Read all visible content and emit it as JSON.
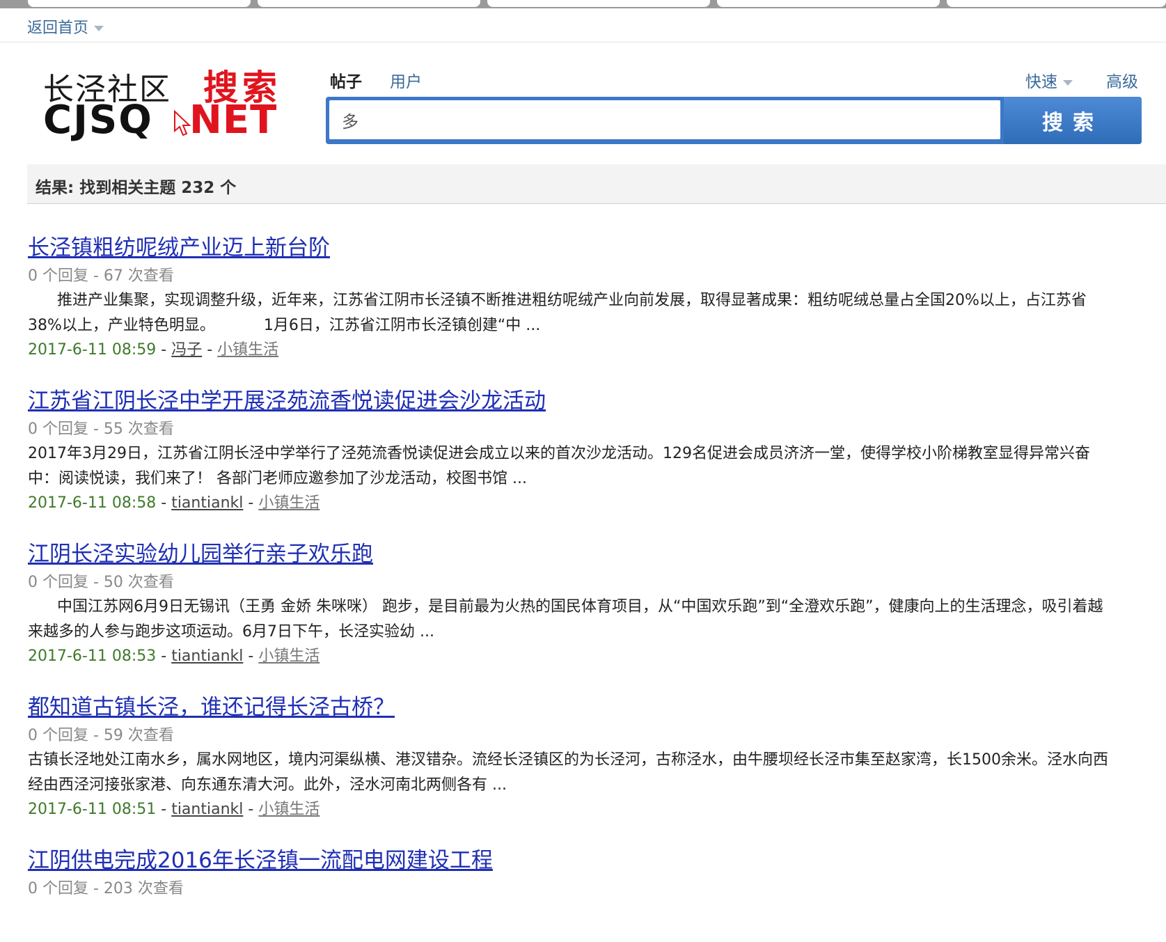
{
  "topbar": {
    "home_label": "返回首页"
  },
  "logo": {
    "cn_text": "长泾社区",
    "search_text": "搜索",
    "en_left": "CJSQ",
    "en_right": "NET"
  },
  "search": {
    "tabs": [
      {
        "label": "帖子"
      },
      {
        "label": "用户"
      }
    ],
    "quick_label": "快速",
    "advanced_label": "高级",
    "input_value": "多",
    "button_label": "搜索"
  },
  "results_bar": {
    "text": "结果: 找到相关主题 232 个"
  },
  "results": [
    {
      "title": "长泾镇粗纺呢绒产业迈上新台阶",
      "stats": "0 个回复 - 67 次查看",
      "summary": "      推进产业集聚，实现调整升级，近年来，江苏省江阴市长泾镇不断推进粗纺呢绒产业向前发展，取得显著成果：粗纺呢绒总量占全国20%以上，占江苏省38%以上，产业特色明显。          1月6日，江苏省江阴市长泾镇创建“中 ...",
      "date": "2017-6-11 08:59",
      "author": "冯子",
      "forum": "小镇生活"
    },
    {
      "title": "江苏省江阴长泾中学开展泾苑流香悦读促进会沙龙活动",
      "stats": "0 个回复 - 55 次查看",
      "summary": "2017年3月29日，江苏省江阴长泾中学举行了泾苑流香悦读促进会成立以来的首次沙龙活动。129名促进会成员济济一堂，使得学校小阶梯教室显得异常兴奋中：阅读悦读，我们来了！ 各部门老师应邀参加了沙龙活动，校图书馆 ...",
      "date": "2017-6-11 08:58",
      "author": "tiantiankl",
      "forum": "小镇生活"
    },
    {
      "title": "江阴长泾实验幼儿园举行亲子欢乐跑",
      "stats": "0 个回复 - 50 次查看",
      "summary": "      中国江苏网6月9日无锡讯（王勇 金娇 朱咪咪） 跑步，是目前最为火热的国民体育项目，从“中国欢乐跑”到“全澄欢乐跑”，健康向上的生活理念，吸引着越来越多的人参与跑步这项运动。6月7日下午，长泾实验幼 ...",
      "date": "2017-6-11 08:53",
      "author": "tiantiankl",
      "forum": "小镇生活"
    },
    {
      "title": "都知道古镇长泾，谁还记得长泾古桥？",
      "stats": "0 个回复 - 59 次查看",
      "summary": "古镇长泾地处江南水乡，属水网地区，境内河渠纵横、港汊错杂。流经长泾镇区的为长泾河，古称泾水，由牛腰坝经长泾市集至赵家湾，长1500余米。泾水向西经由西泾河接张家港、向东通东清大河。此外，泾水河南北两侧各有 ...",
      "date": "2017-6-11 08:51",
      "author": "tiantiankl",
      "forum": "小镇生活"
    },
    {
      "title": "江阴供电完成2016年长泾镇一流配电网建设工程",
      "stats": "0 个回复 - 203 次查看"
    }
  ]
}
